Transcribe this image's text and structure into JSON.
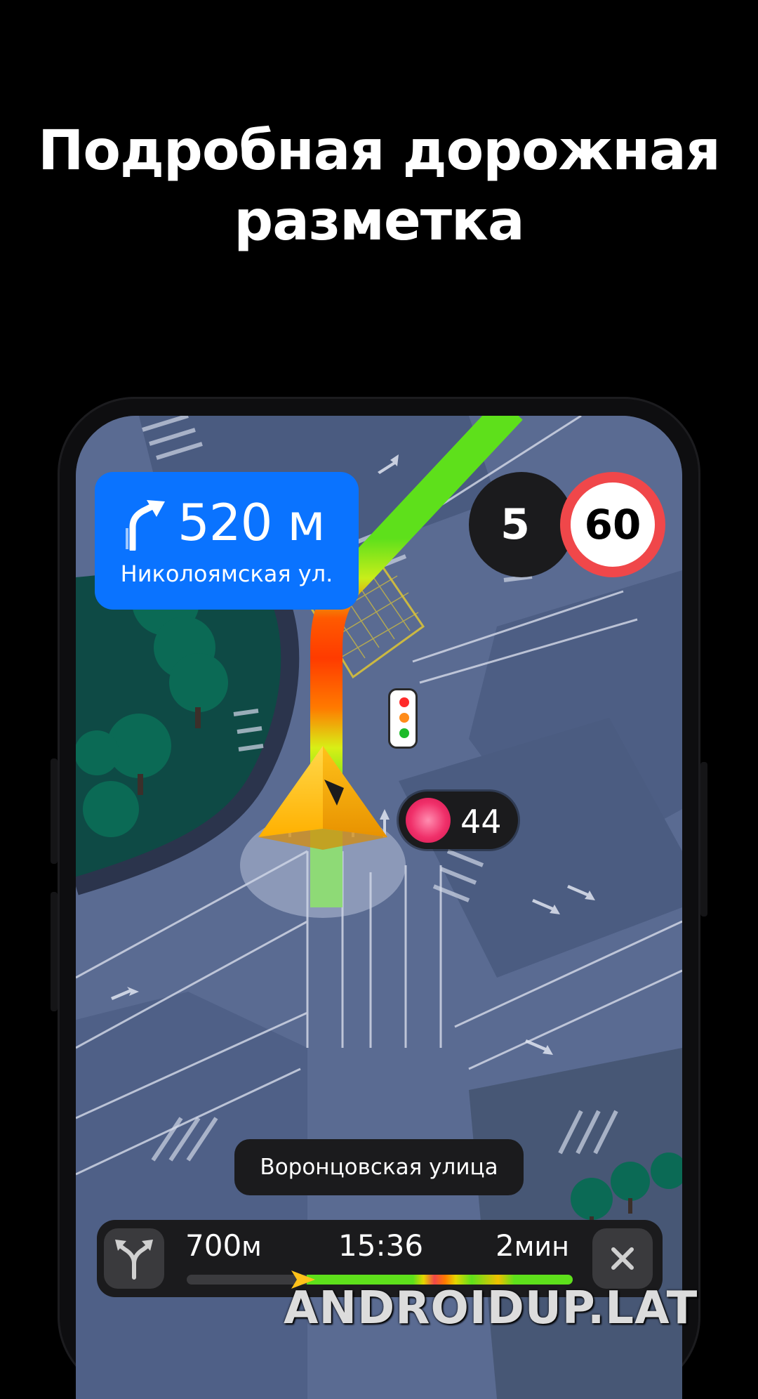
{
  "headline": {
    "line1": "Подробная дорожная",
    "line2": "разметка"
  },
  "navigation": {
    "maneuver": {
      "icon": "turn-right-icon",
      "distance": "520 м",
      "street": "Николоямская ул."
    },
    "lane_count": "5",
    "speed_limit": "60",
    "traffic_light_countdown": "44",
    "current_street": "Воронцовская улица",
    "bottom_bar": {
      "distance_value": "700",
      "distance_unit": "м",
      "arrival_time": "15:36",
      "duration_value": "2",
      "duration_unit": "мин",
      "route_progress": 0.31
    }
  },
  "colors": {
    "accent_blue": "#0a73ff",
    "route_green": "#5ee01b",
    "route_red": "#ff3b00",
    "speed_sign_border": "#f0474a",
    "map_background": "#56688f",
    "cursor_yellow": "#ffc21a"
  },
  "watermark": "ANDROIDUP.LAT"
}
